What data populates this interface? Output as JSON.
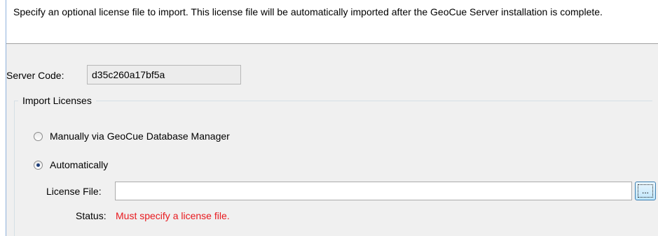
{
  "header": {
    "description": "Specify an optional license file to import.  This license file will be automatically imported after the GeoCue Server installation is complete."
  },
  "server_code": {
    "label": "Server Code:",
    "value": "d35c260a17bf5a"
  },
  "import_group": {
    "legend": "Import Licenses",
    "options": [
      {
        "label": "Manually via GeoCue Database Manager",
        "checked": false
      },
      {
        "label": "Automatically",
        "checked": true
      }
    ]
  },
  "license_file": {
    "label": "License File:",
    "value": "",
    "browse_label": "..."
  },
  "status": {
    "label": "Status:",
    "value": "Must specify a license file.",
    "color": "#e8191e"
  }
}
